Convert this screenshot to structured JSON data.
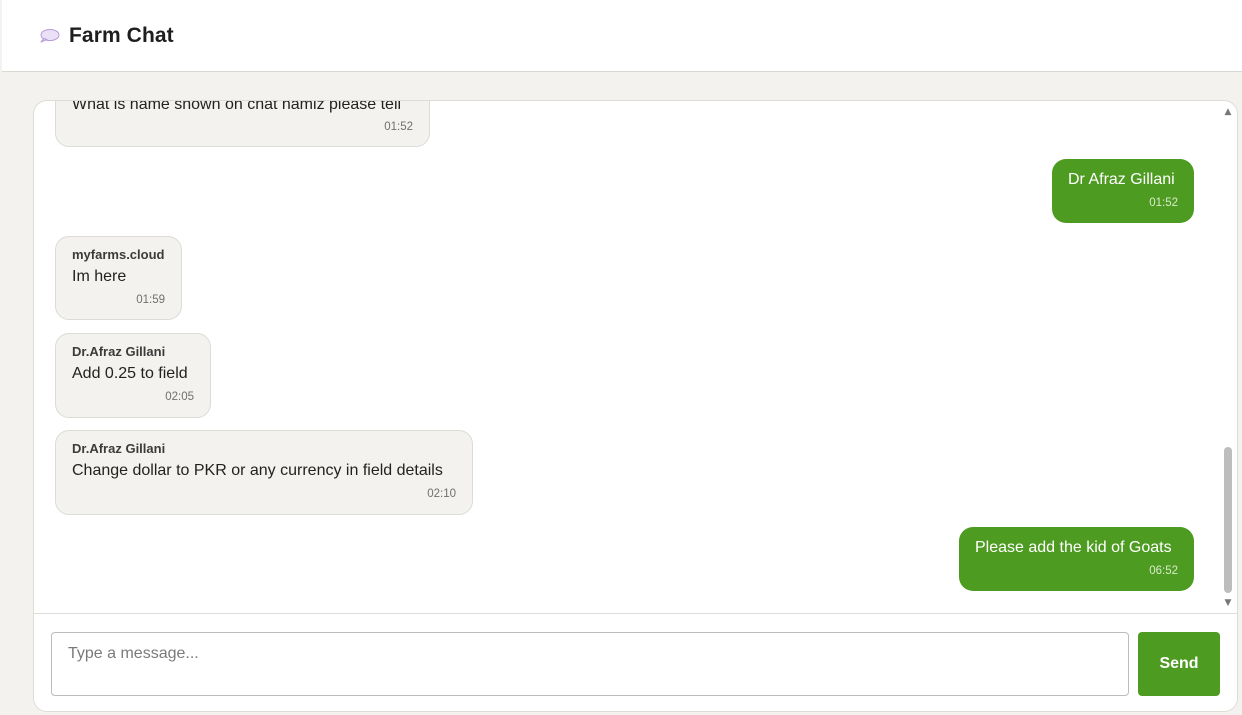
{
  "header": {
    "logo_icon": "speech-bubble-icon",
    "title": "Farm Chat"
  },
  "messages": [
    {
      "direction": "in",
      "sender": "",
      "text": "What is name shown on chat namiz please tell",
      "time": "01:52"
    },
    {
      "direction": "out",
      "text": "Dr Afraz Gillani",
      "time": "01:52"
    },
    {
      "direction": "in",
      "sender": "myfarms.cloud",
      "text": "Im here",
      "time": "01:59"
    },
    {
      "direction": "in",
      "sender": "Dr.Afraz Gillani",
      "text": "Add 0.25 to field",
      "time": "02:05"
    },
    {
      "direction": "in",
      "sender": "Dr.Afraz Gillani",
      "text": "Change dollar to PKR or any currency in field details",
      "time": "02:10"
    },
    {
      "direction": "out",
      "text": "Please add the kid of Goats",
      "time": "06:52"
    }
  ],
  "composer": {
    "placeholder": "Type a message...",
    "value": "",
    "send_label": "Send"
  },
  "colors": {
    "accent": "#4e9b22",
    "incoming_bubble": "#f3f2ee",
    "page_background": "#f3f2ee"
  }
}
